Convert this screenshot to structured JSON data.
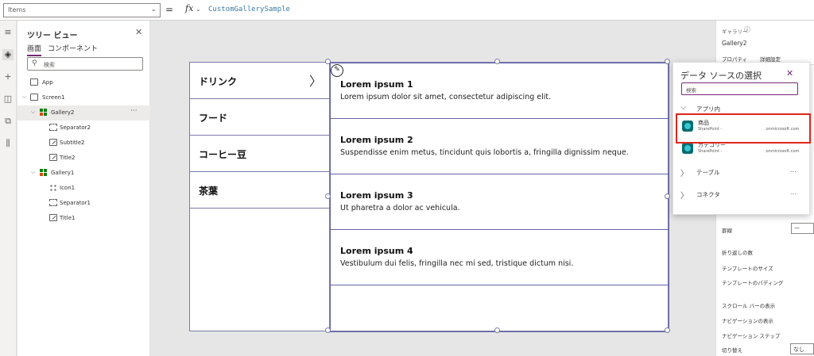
{
  "formula_bar": {
    "property": "Items",
    "fx": "fx",
    "equals": "=",
    "formula": "CustomGallerySample"
  },
  "tree": {
    "title": "ツリー ビュー",
    "tabs": [
      "画面",
      "コンポーネント"
    ],
    "search_placeholder": "検索",
    "nodes": [
      "App",
      "Screen1",
      "Gallery2",
      "Separator2",
      "Subtitle2",
      "Title2",
      "Gallery1",
      "Icon1",
      "Separator1",
      "Title1"
    ]
  },
  "canvas": {
    "categories": [
      "ドリンク",
      "フード",
      "コーヒー豆",
      "茶葉"
    ],
    "gallery_items": [
      {
        "title": "Lorem ipsum 1",
        "subtitle": "Lorem ipsum dolor sit amet, consectetur adipiscing elit."
      },
      {
        "title": "Lorem ipsum 2",
        "subtitle": "Suspendisse enim metus, tincidunt quis lobortis a, fringilla dignissim neque."
      },
      {
        "title": "Lorem ipsum 3",
        "subtitle": "Ut pharetra a dolor ac vehicula."
      },
      {
        "title": "Lorem ipsum 4",
        "subtitle": "Vestibulum dui felis, fringilla nec mi sed, tristique dictum nisi."
      }
    ]
  },
  "properties": {
    "type": "ギャラリー",
    "name": "Gallery2",
    "tabs": [
      "プロパティ",
      "詳細設定"
    ],
    "rows": [
      "罫線",
      "折り返しの数",
      "テンプレートのサイズ",
      "テンプレートのパディング",
      "スクロール バーの表示",
      "ナビゲーションの表示",
      "ナビゲーション ステップ",
      "切り替え"
    ],
    "border_value": "—",
    "wrap_value": "なし"
  },
  "data_source": {
    "title": "データ ソースの選択",
    "search_placeholder": "検索",
    "group_in_app": "アプリ内",
    "items": [
      {
        "name": "商品",
        "source": "SharePoint -",
        "domain": ".onmicrosoft.com"
      },
      {
        "name": "カテゴリー",
        "source": "SharePoint -",
        "domain": ".onmicrosoft.com"
      }
    ],
    "groups": [
      "テーブル",
      "コネクタ"
    ],
    "more": "..."
  }
}
